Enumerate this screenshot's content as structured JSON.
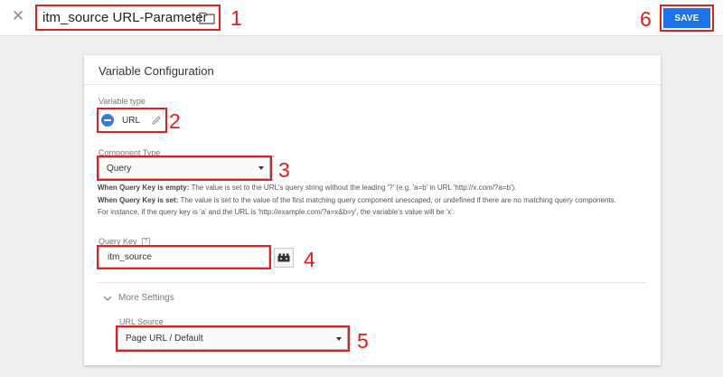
{
  "header": {
    "close_icon": "close-icon",
    "title": "itm_source URL-Parameter",
    "folder_icon": "folder-icon",
    "save_label": "SAVE",
    "save_color": "#1a73e8"
  },
  "annotations": [
    "1",
    "2",
    "3",
    "4",
    "5",
    "6"
  ],
  "annotation_color": "#e21b1b",
  "card": {
    "title": "Variable Configuration",
    "variable_type": {
      "label": "Variable type",
      "value": "URL",
      "icon": "url-variable-icon",
      "edit_icon": "pencil-icon"
    },
    "component_type": {
      "label": "Component Type",
      "value": "Query"
    },
    "help": {
      "empty_bold": "When Query Key is empty:",
      "empty_text": " The value is set to the URL's query string without the leading '?' (e.g. 'a=b' in URL 'http://x.com/?a=b').",
      "set_bold": "When Query Key is set:",
      "set_text": " The value is set to the value of the first matching query component unescaped, or undefined if there are no matching query components.",
      "example": "For instance, if the query key is 'a' and the URL is 'http://example.com/?a=x&b=y', the variable's value will be 'x'."
    },
    "query_key": {
      "label": "Query Key",
      "help_icon": "?",
      "value": "itm_source",
      "picker_icon": "variable-picker-icon"
    },
    "more_settings": {
      "label": "More Settings",
      "url_source_label": "URL Source",
      "url_source_value": "Page URL / Default"
    }
  }
}
